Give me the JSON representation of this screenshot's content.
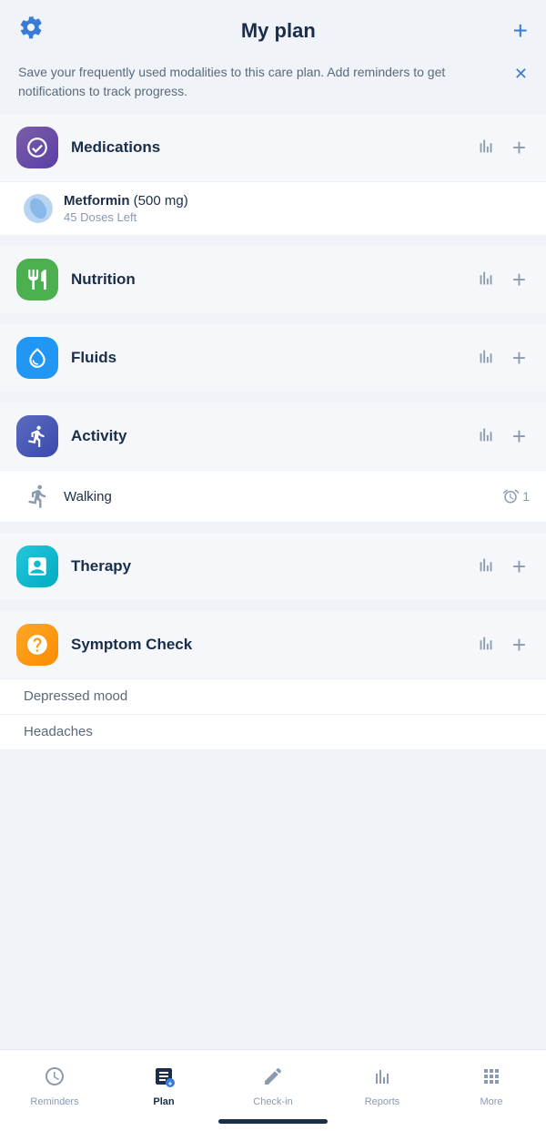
{
  "header": {
    "title": "My plan",
    "settings_icon": "⚙",
    "add_icon": "+"
  },
  "banner": {
    "text": "Save your frequently used modalities to this care plan. Add reminders to get notifications to track progress.",
    "close_icon": "✕"
  },
  "sections": [
    {
      "id": "medications",
      "title": "Medications",
      "icon_color": "bg-purple",
      "sub_items": [
        {
          "type": "medication",
          "name": "Metformin (500 mg)",
          "detail": "45 Doses Left",
          "has_icon": true
        }
      ]
    },
    {
      "id": "nutrition",
      "title": "Nutrition",
      "icon_color": "bg-green",
      "sub_items": []
    },
    {
      "id": "fluids",
      "title": "Fluids",
      "icon_color": "bg-blue",
      "sub_items": []
    },
    {
      "id": "activity",
      "title": "Activity",
      "icon_color": "bg-indigo",
      "sub_items": [
        {
          "type": "activity",
          "name": "Walking",
          "alarm_count": "1"
        }
      ]
    },
    {
      "id": "therapy",
      "title": "Therapy",
      "icon_color": "bg-teal",
      "sub_items": []
    },
    {
      "id": "symptom-check",
      "title": "Symptom Check",
      "icon_color": "bg-orange",
      "sub_items": [
        {
          "type": "symptom",
          "name": "Depressed mood"
        },
        {
          "type": "symptom",
          "name": "Headaches"
        }
      ]
    }
  ],
  "nav": {
    "items": [
      {
        "id": "reminders",
        "label": "Reminders",
        "active": false
      },
      {
        "id": "plan",
        "label": "Plan",
        "active": true
      },
      {
        "id": "check-in",
        "label": "Check-in",
        "active": false
      },
      {
        "id": "reports",
        "label": "Reports",
        "active": false
      },
      {
        "id": "more",
        "label": "More",
        "active": false
      }
    ]
  }
}
